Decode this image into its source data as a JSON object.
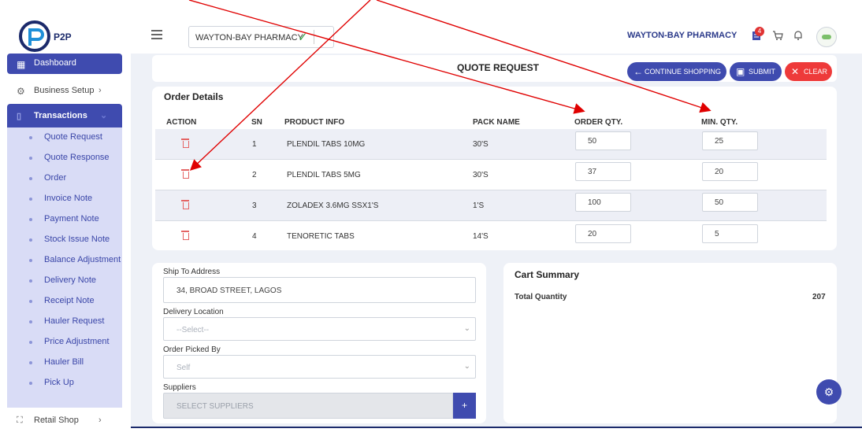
{
  "header": {
    "logo_text": "P2P",
    "pharmacy_select_value": "WAYTON-BAY PHARMACY",
    "pharmacy_name": "WAYTON-BAY PHARMACY",
    "notification_count": "4"
  },
  "sidebar": {
    "dashboard": "Dashboard",
    "business_setup": "Business Setup",
    "transactions": "Transactions",
    "sub_items": [
      "Quote Request",
      "Quote Response",
      "Order",
      "Invoice Note",
      "Payment Note",
      "Stock Issue Note",
      "Balance Adjustment",
      "Delivery Note",
      "Receipt Note",
      "Hauler Request",
      "Price Adjustment",
      "Hauler Bill",
      "Pick Up"
    ],
    "retail_shop": "Retail Shop"
  },
  "page": {
    "title": "QUOTE REQUEST",
    "continue_label": "CONTINUE SHOPPING",
    "submit_label": "SUBMIT",
    "clear_label": "CLEAR"
  },
  "order": {
    "title": "Order Details",
    "columns": [
      "ACTION",
      "SN",
      "PRODUCT INFO",
      "PACK NAME",
      "ORDER QTY.",
      "MIN. QTY."
    ],
    "rows": [
      {
        "sn": "1",
        "product": "PLENDIL TABS 10MG",
        "pack": "30'S",
        "order_qty": "50",
        "min_qty": "25"
      },
      {
        "sn": "2",
        "product": "PLENDIL TABS 5MG",
        "pack": "30'S",
        "order_qty": "37",
        "min_qty": "20"
      },
      {
        "sn": "3",
        "product": "ZOLADEX 3.6MG SSX1'S",
        "pack": "1'S",
        "order_qty": "100",
        "min_qty": "50"
      },
      {
        "sn": "4",
        "product": "TENORETIC TABS",
        "pack": "14'S",
        "order_qty": "20",
        "min_qty": "5"
      }
    ]
  },
  "shipping": {
    "ship_label": "Ship To Address",
    "ship_value": "34, BROAD STREET, LAGOS",
    "delivery_label": "Delivery Location",
    "delivery_value": "--Select--",
    "picked_label": "Order Picked By",
    "picked_value": "Self",
    "suppliers_label": "Suppliers",
    "suppliers_placeholder": "SELECT SUPPLIERS",
    "add_symbol": "+"
  },
  "cart": {
    "title": "Cart Summary",
    "total_label": "Total Quantity",
    "total_value": "207"
  },
  "colors": {
    "primary": "#3f4baf",
    "danger": "#ee3a3a",
    "annotation": "#e00000"
  }
}
